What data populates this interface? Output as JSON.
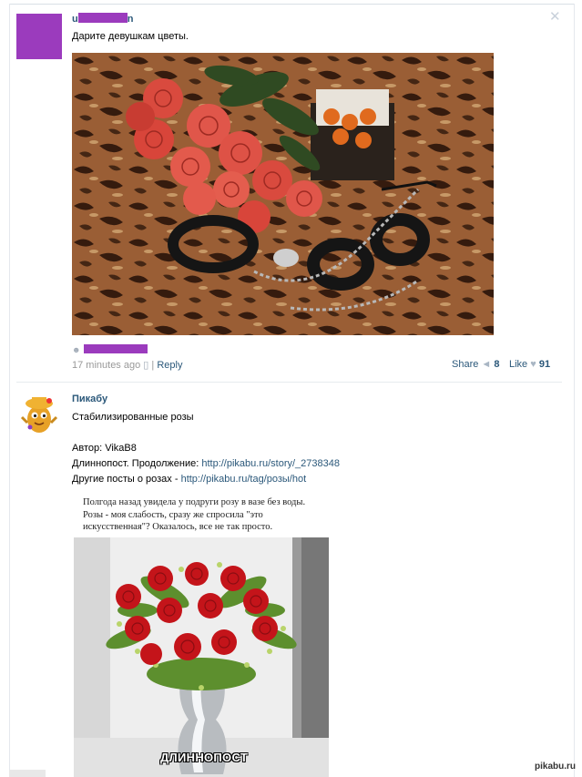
{
  "post1": {
    "author_visible": "u",
    "author_tail": "n",
    "text": "Дарите девушкам цветы.",
    "time": "17 minutes ago",
    "reply": "Reply",
    "sep": "|",
    "share_label": "Share",
    "share_count": "8",
    "like_label": "Like",
    "like_count": "91"
  },
  "post2": {
    "author": "Пикабу",
    "title": "Стабилизированные розы",
    "author_line_label": "Автор:",
    "author_line_value": "VikaB8",
    "continue_label": "Длиннопост. Продолжение:",
    "continue_link": "http://pikabu.ru/story/_2738348",
    "other_label": "Другие посты о розах -",
    "other_link": "http://pikabu.ru/tag/розы/hot",
    "quote": "Полгода назад увидела у подруги розу в вазе без воды. Розы - моя слабость, сразу же спросила \"это искусственная\"? Оказалось, все не так просто.",
    "image_caption": "ДЛИННОПОСТ"
  },
  "icons": {
    "close": "close-icon",
    "person": "person-icon",
    "phone": "phone-icon",
    "share": "share-icon",
    "like": "heart-icon"
  },
  "colors": {
    "link": "#2b587a",
    "redaction": "#9b3bbd",
    "muted": "#999999"
  },
  "watermark": "pikabu.ru"
}
